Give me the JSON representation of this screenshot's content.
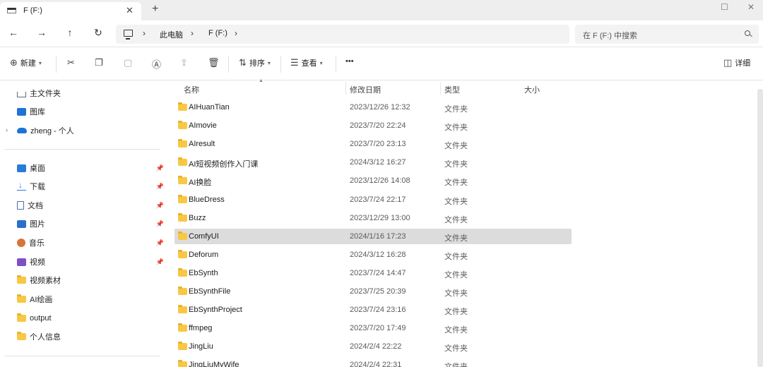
{
  "tab": {
    "title": "F (F:)",
    "close": "✕",
    "new_tab": "+"
  },
  "window": {
    "maximize": "☐",
    "close": "✕"
  },
  "nav": {
    "back": "←",
    "forward": "→",
    "up": "↑",
    "refresh": "↻"
  },
  "breadcrumb": {
    "sep": "›",
    "items": [
      "此电脑",
      "F (F:)"
    ]
  },
  "search": {
    "placeholder": "在 F (F:) 中搜索"
  },
  "toolbar": {
    "new_label": "新建",
    "sort_label": "排序",
    "view_label": "查看",
    "more": "•••",
    "details_label": "详细"
  },
  "sidebar": {
    "home": "主文件夹",
    "gallery": "图库",
    "cloud": "zheng - 个人",
    "pinned": [
      "桌面",
      "下载",
      "文档",
      "图片",
      "音乐",
      "视频"
    ],
    "folders": [
      "视频素材",
      "AI绘画",
      "output",
      "个人信息"
    ]
  },
  "columns": {
    "name": "名称",
    "date": "修改日期",
    "type": "类型",
    "size": "大小"
  },
  "files": [
    {
      "name": "AIHuanTian",
      "date": "2023/12/26 12:32",
      "type": "文件夹"
    },
    {
      "name": "AImovie",
      "date": "2023/7/20 22:24",
      "type": "文件夹"
    },
    {
      "name": "AIresult",
      "date": "2023/7/20 23:13",
      "type": "文件夹"
    },
    {
      "name": "AI短视频创作入门课",
      "date": "2024/3/12 16:27",
      "type": "文件夹"
    },
    {
      "name": "AI换脸",
      "date": "2023/12/26 14:08",
      "type": "文件夹"
    },
    {
      "name": "BlueDress",
      "date": "2023/7/24 22:17",
      "type": "文件夹"
    },
    {
      "name": "Buzz",
      "date": "2023/12/29 13:00",
      "type": "文件夹"
    },
    {
      "name": "ComfyUI",
      "date": "2024/1/16 17:23",
      "type": "文件夹"
    },
    {
      "name": "Deforum",
      "date": "2024/3/12 16:28",
      "type": "文件夹"
    },
    {
      "name": "EbSynth",
      "date": "2023/7/24 14:47",
      "type": "文件夹"
    },
    {
      "name": "EbSynthFile",
      "date": "2023/7/25 20:39",
      "type": "文件夹"
    },
    {
      "name": "EbSynthProject",
      "date": "2023/7/24 23:16",
      "type": "文件夹"
    },
    {
      "name": "ffmpeg",
      "date": "2023/7/20 17:49",
      "type": "文件夹"
    },
    {
      "name": "JingLiu",
      "date": "2024/2/4 22:22",
      "type": "文件夹"
    },
    {
      "name": "JingLiuMyWife",
      "date": "2024/2/4 22:31",
      "type": "文件夹"
    }
  ],
  "selected_file": "ComfyUI"
}
